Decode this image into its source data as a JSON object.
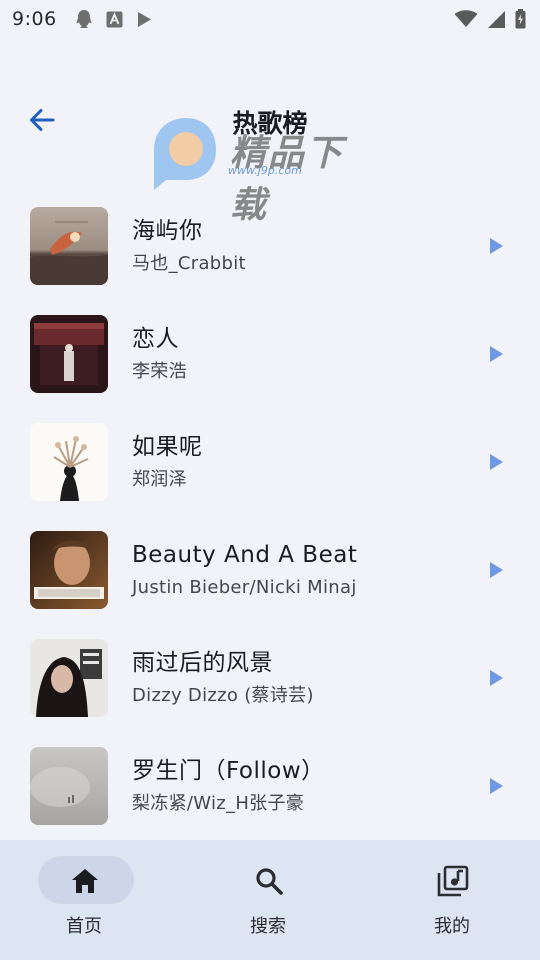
{
  "status_bar": {
    "time": "9:06"
  },
  "header": {
    "title": "热歌榜"
  },
  "watermark": {
    "main_text": "精品下载",
    "url": "www.j9p.com"
  },
  "songs": [
    {
      "title": "海屿你",
      "artist": "马也_Crabbit"
    },
    {
      "title": "恋人",
      "artist": "李荣浩"
    },
    {
      "title": "如果呢",
      "artist": "郑润泽"
    },
    {
      "title": "Beauty And A Beat",
      "artist": "Justin Bieber/Nicki Minaj"
    },
    {
      "title": "雨过后的风景",
      "artist": "Dizzy Dizzo (蔡诗芸)"
    },
    {
      "title": "罗生门（Follow）",
      "artist": "梨冻紧/Wiz_H张子豪"
    }
  ],
  "bottom_nav": {
    "items": [
      {
        "label": "首页",
        "icon": "home-icon",
        "selected": true
      },
      {
        "label": "搜索",
        "icon": "search-icon",
        "selected": false
      },
      {
        "label": "我的",
        "icon": "music-library-icon",
        "selected": false
      }
    ]
  },
  "colors": {
    "background": "#f1f3f9",
    "accent": "#1f5fbf",
    "play": "#6f98e0",
    "nav_background": "#dde4f2",
    "nav_pill": "#ccd6e8"
  }
}
